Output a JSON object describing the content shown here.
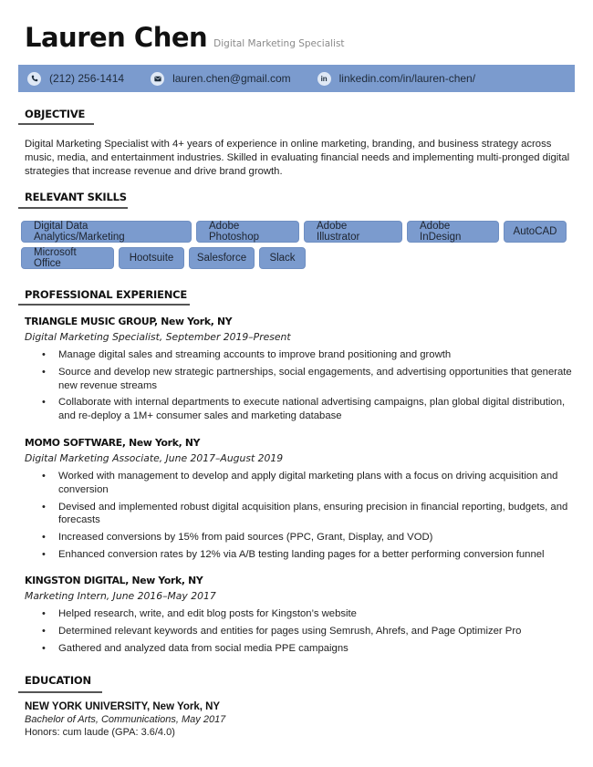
{
  "header": {
    "name": "Lauren Chen",
    "title": "Digital Marketing Specialist"
  },
  "contact": {
    "phone": {
      "icon": "phone-icon",
      "text": "(212) 256-1414"
    },
    "email": {
      "icon": "email-icon",
      "text": "lauren.chen@gmail.com"
    },
    "linkedin": {
      "icon": "linkedin-icon",
      "glyph": "in",
      "text": "linkedin.com/in/lauren-chen/"
    }
  },
  "colors": {
    "accent": "#7b9bce",
    "rule": "#555555",
    "text": "#222222"
  },
  "objective": {
    "heading": "OBJECTIVE",
    "text": "Digital Marketing Specialist with 4+ years of experience in online marketing, branding, and business strategy across music, media, and entertainment industries. Skilled in evaluating financial needs and implementing multi-pronged digital strategies that increase revenue and drive brand growth."
  },
  "skills": {
    "heading": "RELEVANT SKILLS",
    "items": [
      "Digital Data Analytics/Marketing",
      "Adobe Photoshop",
      "Adobe Illustrator",
      "Adobe InDesign",
      "AutoCAD",
      "Microsoft Office",
      "Hootsuite",
      "Salesforce",
      "Slack"
    ]
  },
  "experience": {
    "heading": "PROFESSIONAL EXPERIENCE",
    "jobs": [
      {
        "company": "TRIANGLE MUSIC GROUP, New York, NY",
        "role": "Digital Marketing Specialist, September 2019–Present",
        "bullets": [
          "Manage digital sales and streaming accounts to improve brand positioning and growth",
          "Source and develop new strategic partnerships, social engagements, and advertising opportunities that generate new revenue streams",
          "Collaborate with internal departments to execute national advertising campaigns, plan global digital distribution, and re-deploy a 1M+ consumer sales and marketing database"
        ]
      },
      {
        "company": "MOMO SOFTWARE, New York, NY",
        "role": "Digital Marketing Associate, June 2017–August 2019",
        "bullets": [
          "Worked with management to develop and apply digital marketing plans with a focus on driving acquisition and conversion",
          "Devised and implemented robust digital acquisition plans, ensuring precision in financial reporting, budgets, and forecasts",
          "Increased conversions by 15% from paid sources (PPC, Grant, Display, and VOD)",
          "Enhanced conversion rates by 12% via A/B testing landing pages for a better performing conversion funnel"
        ]
      },
      {
        "company": "KINGSTON DIGITAL, New York, NY",
        "role": "Marketing Intern, June 2016–May 2017",
        "bullets": [
          "Helped research, write, and edit blog posts for Kingston’s website",
          "Determined relevant keywords and entities for pages using Semrush, Ahrefs, and Page Optimizer Pro",
          "Gathered and analyzed data from social media PPE campaigns"
        ]
      }
    ]
  },
  "education": {
    "heading": "EDUCATION",
    "school": "NEW YORK UNIVERSITY, New York, NY",
    "degree": "Bachelor of Arts, Communications, May 2017",
    "honors": "Honors: cum laude (GPA: 3.6/4.0)"
  },
  "bullet_glyph": "•"
}
